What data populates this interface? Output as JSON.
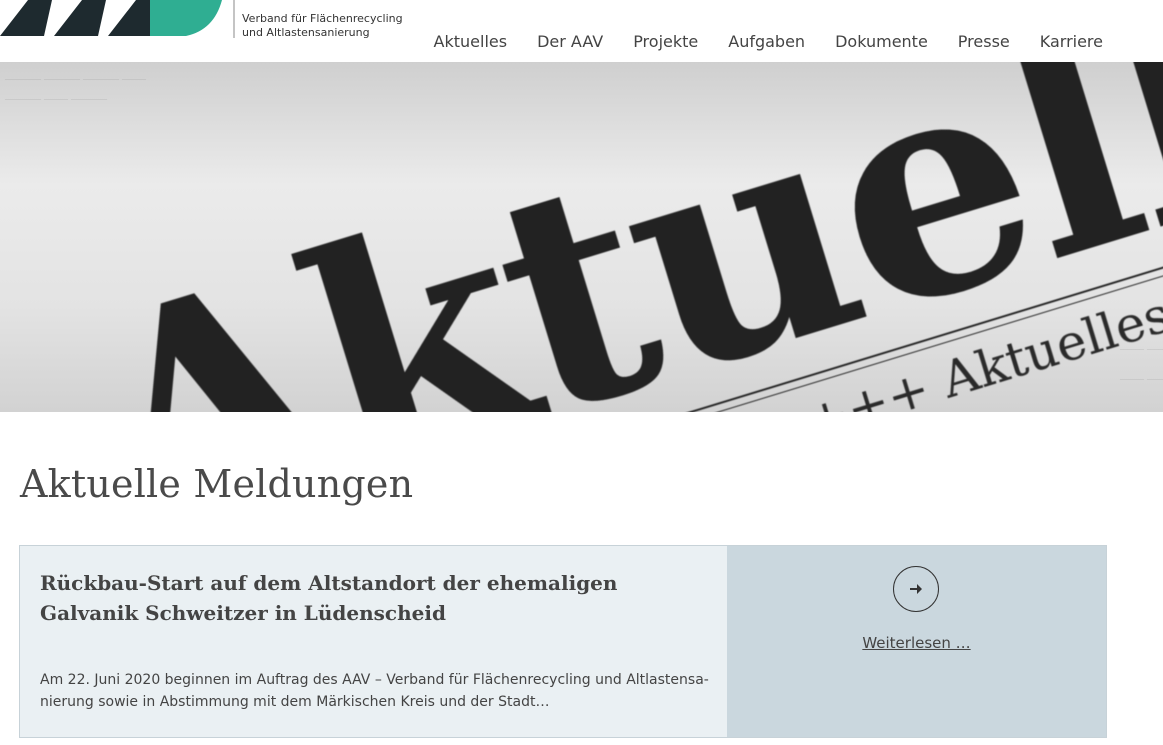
{
  "header": {
    "logo_alt": "AAV",
    "tagline_line1": "Verband für Flächenrecycling",
    "tagline_line2": "und Altlastensanierung",
    "brand_colors": {
      "dark": "#1e2a2f",
      "teal": "#2fae92"
    }
  },
  "nav": {
    "items": [
      {
        "label": "Aktuelles"
      },
      {
        "label": "Der AAV"
      },
      {
        "label": "Projekte"
      },
      {
        "label": "Aufgaben"
      },
      {
        "label": "Dokumente"
      },
      {
        "label": "Presse"
      },
      {
        "label": "Karriere"
      }
    ]
  },
  "hero": {
    "headline": "Aktuelles",
    "ticker": "Nachrichten +++ Aktuelles +++ In"
  },
  "main": {
    "section_title": "Aktuelle Meldungen",
    "articles": [
      {
        "title": "Rückbau-Start auf dem Altstandort der ehemaligen Galvanik Schweitzer in Lüdenscheid",
        "excerpt": "Am 22. Juni 2020 beginnen im Auftrag des AAV – Verband für Flächenrecycling und Altlastensa­nierung sowie in Abstimmung mit dem Märkischen Kreis und der Stadt…",
        "read_more": "Weiterlesen …",
        "icon": "arrow-right-icon"
      }
    ]
  }
}
